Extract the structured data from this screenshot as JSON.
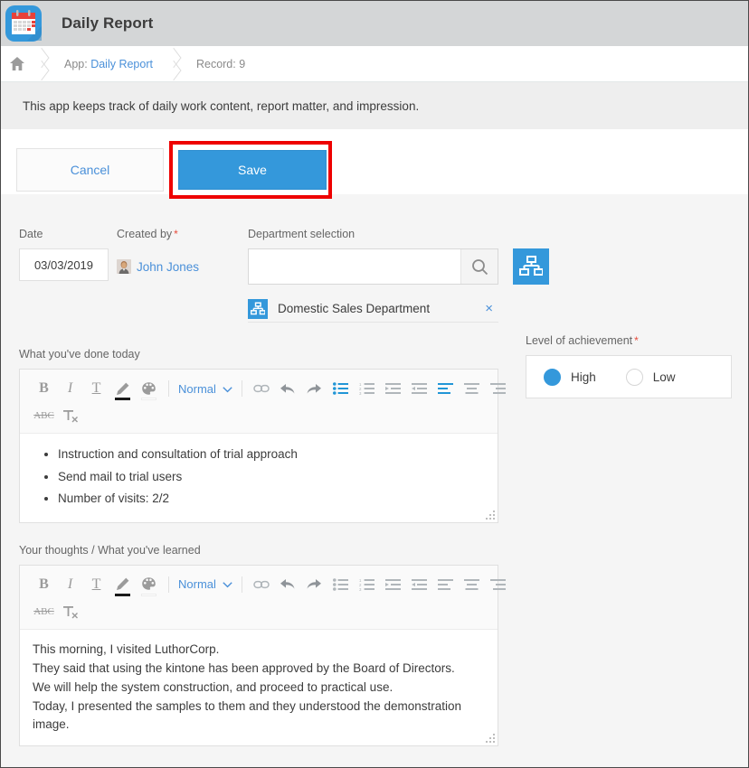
{
  "header": {
    "app_icon": "calendar-app-icon",
    "title": "Daily Report"
  },
  "breadcrumb": {
    "home_icon": "home-icon",
    "app_prefix": "App: ",
    "app_name": "Daily Report",
    "record": "Record: 9"
  },
  "description": "This app keeps track of daily work content, report matter, and impression.",
  "actions": {
    "cancel_label": "Cancel",
    "save_label": "Save",
    "highlight_color": "#ee0000",
    "save_color": "#3498db"
  },
  "fields": {
    "date": {
      "label": "Date",
      "value": "03/03/2019"
    },
    "created_by": {
      "label": "Created by",
      "required": "*",
      "user": "John Jones"
    },
    "department": {
      "label": "Department selection",
      "search_value": "",
      "search_placeholder": "",
      "search_icon": "search-icon",
      "picker_icon": "org-chart-icon",
      "selected": {
        "icon": "org-chart-icon",
        "name": "Domestic Sales Department",
        "remove": "×"
      }
    },
    "done_today": {
      "label": "What you've done today",
      "items": [
        "Instruction and consultation of trial approach",
        "Send mail to trial users",
        "Number of visits: 2/2"
      ]
    },
    "thoughts": {
      "label": "Your thoughts / What you've learned",
      "lines": [
        "This morning, I visited LuthorCorp.",
        "They said that using the kintone has been approved by the Board of Directors.",
        "We will help the system construction, and proceed to practical use.",
        "Today, I presented the samples to them and they understood the demonstration",
        "image."
      ]
    },
    "achievement": {
      "label": "Level of achievement",
      "required": "*",
      "options": [
        {
          "label": "High",
          "selected": true
        },
        {
          "label": "Low",
          "selected": false
        }
      ]
    }
  },
  "toolbar": {
    "bold": "B",
    "italic": "I",
    "underline": "T",
    "text_color_icon": "pencil-icon",
    "bg_color_icon": "palette-icon",
    "style_value": "Normal",
    "caret_icon": "chevron-down-icon",
    "link_icon": "link-icon",
    "undo_icon": "undo-icon",
    "redo_icon": "redo-icon",
    "bullet_list_icon": "bullet-list-icon",
    "numbered_list_icon": "numbered-list-icon",
    "indent_icon": "indent-icon",
    "outdent_icon": "outdent-icon",
    "align_left_icon": "align-left-icon",
    "align_center_icon": "align-center-icon",
    "align_right_icon": "align-right-icon",
    "strikethrough": "ABC",
    "clear_format": "Tx",
    "active_color": "#2196d6",
    "inactive_color": "#b0b6ba"
  }
}
